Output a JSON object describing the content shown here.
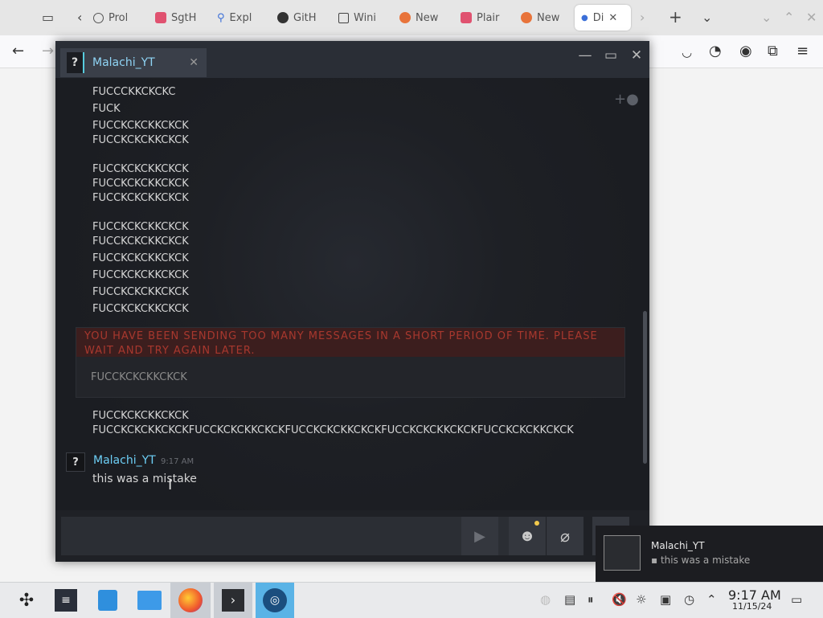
{
  "browser": {
    "tabs": [
      {
        "label": "Prol"
      },
      {
        "label": "SgtH"
      },
      {
        "label": "Expl"
      },
      {
        "label": "GitH"
      },
      {
        "label": "Wini"
      },
      {
        "label": "New"
      },
      {
        "label": "Plair"
      },
      {
        "label": "New"
      },
      {
        "label": "Di"
      }
    ]
  },
  "chat": {
    "tab_name": "Malachi_YT",
    "avatar_glyph": "?",
    "messages_before": [
      "FUCCCKKCKCKC",
      "FUCK",
      "FUCCKCKCKKCKCK",
      "FUCCKCKCKKCKCK",
      "FUCCKCKCKKCKCK",
      "FUCCKCKCKKCKCK",
      "FUCCKCKCKKCKCK",
      "FUCCKCKCKKCKCK",
      "FUCCKCKCKKCKCK",
      "FUCCKCKCKKCKCK",
      "FUCCKCKCKKCKCK",
      "FUCCKCKCKKCKCK",
      "FUCCKCKCKKCKCK"
    ],
    "rate_limit": {
      "warning": "YOU HAVE BEEN SENDING TOO MANY MESSAGES IN A SHORT PERIOD OF TIME. PLEASE WAIT AND TRY AGAIN LATER.",
      "failed_message": "FUCCKCKCKKCKCK"
    },
    "messages_after": [
      "FUCCKCKCKKCKCK",
      "FUCCKCKCKKCKCKFUCCKCKCKKCKCKFUCCKCKCKKCKCKFUCCKCKCKKCKCKFUCCKCKCKKCKCK"
    ],
    "last_group": {
      "author": "Malachi_YT",
      "time": "9:17 AM",
      "message": "this was a mistake"
    },
    "input": {
      "value": ""
    }
  },
  "notification": {
    "title": "Malachi_YT",
    "message": "this was a mistake"
  },
  "taskbar": {
    "time": "9:17 AM",
    "date": "11/15/24"
  },
  "colors": {
    "chat_bg": "#1b1d22",
    "friend_name": "#6dcff6",
    "rate_limit_text": "#a8382e",
    "rate_limit_bg": "#3c1e1e"
  }
}
